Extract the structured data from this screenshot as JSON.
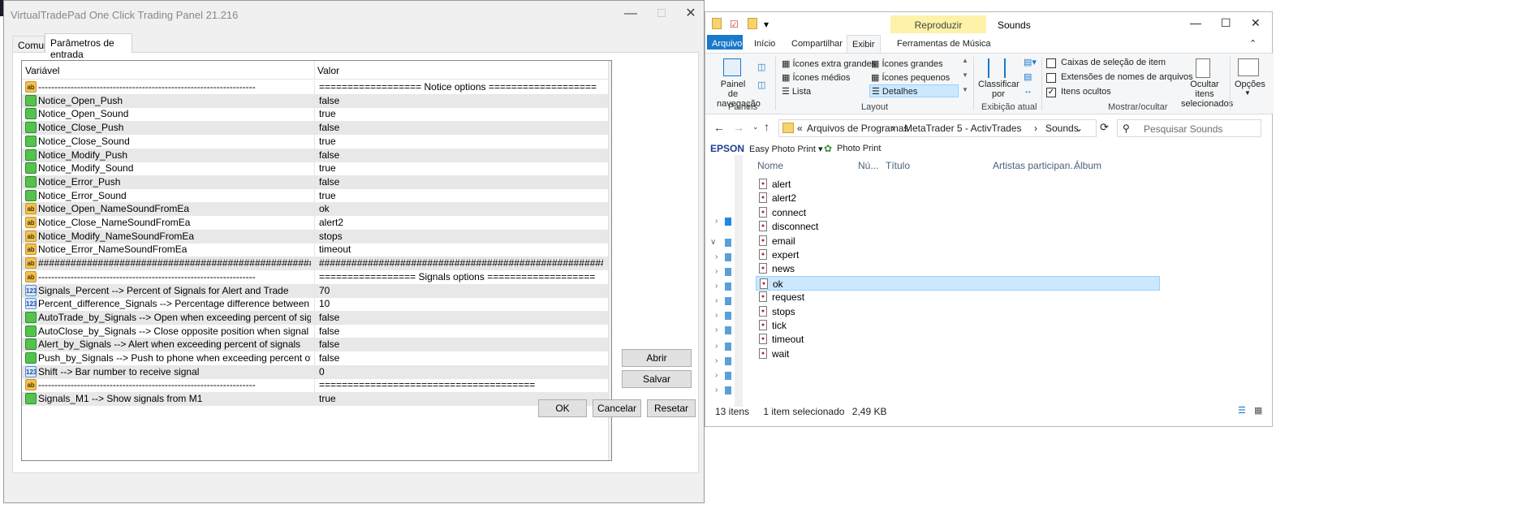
{
  "dialog": {
    "title": "VirtualTradePad One Click Trading Panel 21.216",
    "tabs": [
      "Comum",
      "Parâmetros de entrada"
    ],
    "columns": {
      "variable": "Variável",
      "value": "Valor"
    },
    "rows": [
      {
        "type": "str",
        "name": "-------------------------------------------------------------------",
        "value": "==================  Notice options  ==================="
      },
      {
        "type": "bool",
        "name": "Notice_Open_Push",
        "value": "false"
      },
      {
        "type": "bool",
        "name": "Notice_Open_Sound",
        "value": "true"
      },
      {
        "type": "bool",
        "name": "Notice_Close_Push",
        "value": "false"
      },
      {
        "type": "bool",
        "name": "Notice_Close_Sound",
        "value": "true"
      },
      {
        "type": "bool",
        "name": "Notice_Modify_Push",
        "value": "false"
      },
      {
        "type": "bool",
        "name": "Notice_Modify_Sound",
        "value": "true"
      },
      {
        "type": "bool",
        "name": "Notice_Error_Push",
        "value": "false"
      },
      {
        "type": "bool",
        "name": "Notice_Error_Sound",
        "value": "true"
      },
      {
        "type": "str",
        "name": "Notice_Open_NameSoundFromEa",
        "value": "ok"
      },
      {
        "type": "str",
        "name": "Notice_Close_NameSoundFromEa",
        "value": "alert2"
      },
      {
        "type": "str",
        "name": "Notice_Modify_NameSoundFromEa",
        "value": "stops"
      },
      {
        "type": "str",
        "name": "Notice_Error_NameSoundFromEa",
        "value": "timeout"
      },
      {
        "type": "str",
        "name": "#####################################################...",
        "value": "#####################################################..."
      },
      {
        "type": "str",
        "name": "-------------------------------------------------------------------",
        "value": "=================  Signals options  ==================="
      },
      {
        "type": "num",
        "name": "Signals_Percent --> Percent of Signals for Alert and Trade",
        "value": "70"
      },
      {
        "type": "num",
        "name": "Percent_difference_Signals --> Percentage difference between si",
        "value": "10"
      },
      {
        "type": "bool",
        "name": "AutoTrade_by_Signals --> Open when exceeding percent of signals",
        "value": "false"
      },
      {
        "type": "bool",
        "name": "AutoClose_by_Signals --> Close opposite position when signal ch",
        "value": "false"
      },
      {
        "type": "bool",
        "name": "Alert_by_Signals --> Alert when exceeding percent of signals",
        "value": "false"
      },
      {
        "type": "bool",
        "name": "Push_by_Signals --> Push to phone when exceeding percent of sig",
        "value": "false"
      },
      {
        "type": "num",
        "name": "Shift --> Bar number to receive signal",
        "value": "0"
      },
      {
        "type": "str",
        "name": "-------------------------------------------------------------------",
        "value": "======================================"
      },
      {
        "type": "bool",
        "name": "Signals_M1 --> Show signals from M1",
        "value": "true"
      }
    ],
    "buttons": {
      "open": "Abrir",
      "save": "Salvar",
      "ok": "OK",
      "cancel": "Cancelar",
      "reset": "Resetar"
    }
  },
  "explorer": {
    "title": "Sounds",
    "context_tab": "Reproduzir",
    "ribbon_tabs": [
      "Arquivo",
      "Início",
      "Compartilhar",
      "Exibir",
      "Ferramentas de Música"
    ],
    "layout_options": [
      "Ícones extra grandes",
      "Ícones grandes",
      "Ícones médios",
      "Ícones pequenos",
      "Lista",
      "Detalhes"
    ],
    "nav_pane_label": "Painel de navegação",
    "groups": {
      "panes": "Painéis",
      "layout": "Layout",
      "current_view": "Exibição atual",
      "show_hide": "Mostrar/ocultar"
    },
    "sort_label": "Classificar por",
    "checkboxes": [
      {
        "label": "Caixas de seleção de item",
        "checked": false
      },
      {
        "label": "Extensões de nomes de arquivos",
        "checked": false
      },
      {
        "label": "Itens ocultos",
        "checked": true
      }
    ],
    "hide_selected": "Ocultar itens selecionados",
    "options": "Opções",
    "breadcrumb": [
      "Arquivos de Programas",
      "MetaTrader 5 - ActivTrades",
      "Sounds"
    ],
    "search_placeholder": "Pesquisar Sounds",
    "epson": {
      "brand": "EPSON",
      "easy": "Easy Photo Print",
      "photo": "Photo Print"
    },
    "columns": [
      "Nome",
      "Nú...",
      "Título",
      "Artistas participan...",
      "Álbum"
    ],
    "files": [
      "alert",
      "alert2",
      "connect",
      "disconnect",
      "email",
      "expert",
      "news",
      "ok",
      "request",
      "stops",
      "tick",
      "timeout",
      "wait"
    ],
    "selected_file": "ok",
    "status": {
      "count": "13 itens",
      "selected": "1 item selecionado",
      "size": "2,49 KB"
    }
  }
}
